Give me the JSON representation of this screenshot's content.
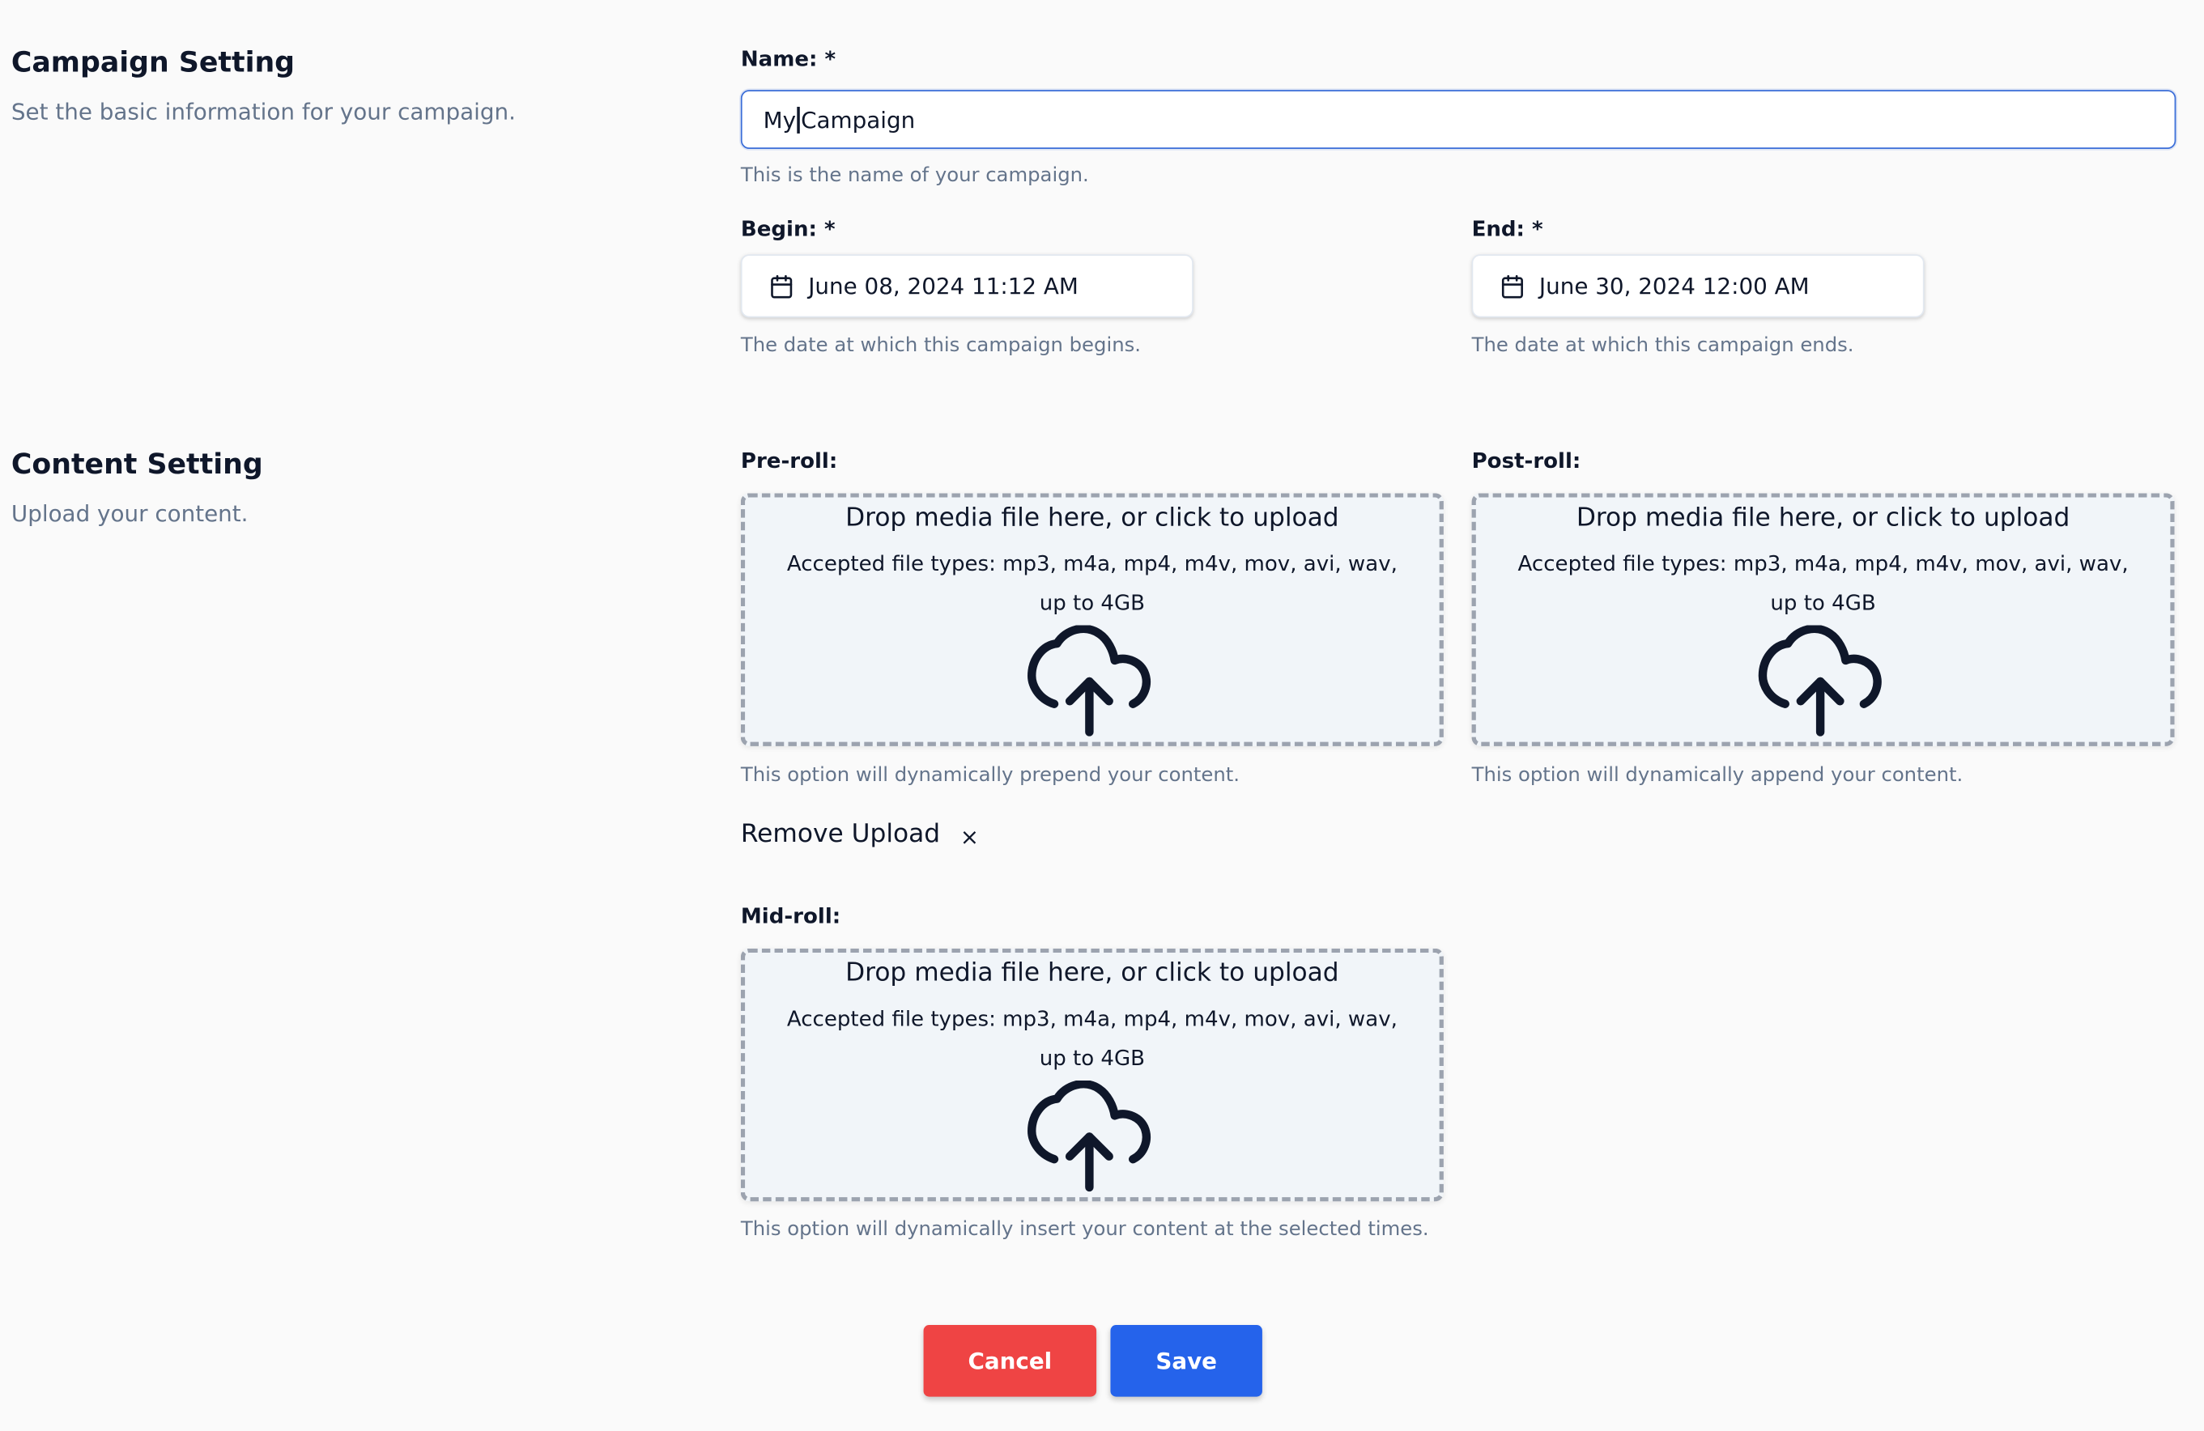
{
  "campaign_setting": {
    "title": "Campaign Setting",
    "description": "Set the basic information for your campaign."
  },
  "name_field": {
    "label": "Name: *",
    "value_before_caret": "My",
    "value_after_caret": "Campaign",
    "hint": "This is the name of your campaign."
  },
  "begin_field": {
    "label": "Begin: *",
    "value": "June 08, 2024 11:12 AM",
    "hint": "The date at which this campaign begins."
  },
  "end_field": {
    "label": "End: *",
    "value": "June 30, 2024 12:00 AM",
    "hint": "The date at which this campaign ends."
  },
  "content_setting": {
    "title": "Content Setting",
    "description": "Upload your content."
  },
  "dropzone_text": {
    "title": "Drop media file here, or click to upload",
    "accepted": "Accepted file types: mp3, m4a, mp4, m4v, mov, avi, wav,",
    "limit": "up to 4GB"
  },
  "pre_roll": {
    "label": "Pre-roll:",
    "hint": "This option will dynamically prepend your content."
  },
  "post_roll": {
    "label": "Post-roll:",
    "hint": "This option will dynamically append your content."
  },
  "remove_upload": {
    "label": "Remove Upload",
    "close_symbol": "×"
  },
  "mid_roll": {
    "label": "Mid-roll:",
    "hint": "This option will dynamically insert your content at the selected times."
  },
  "actions": {
    "cancel_label": "Cancel",
    "save_label": "Save"
  },
  "colors": {
    "cancel": "#ef4444",
    "save": "#2563eb",
    "input_focus_border": "#3b6ed8",
    "muted_text": "#64748b",
    "dropzone_bg": "#f1f5f9"
  },
  "icons": {
    "date": "calendar-icon",
    "upload": "cloud-upload-icon",
    "remove": "close-icon"
  }
}
